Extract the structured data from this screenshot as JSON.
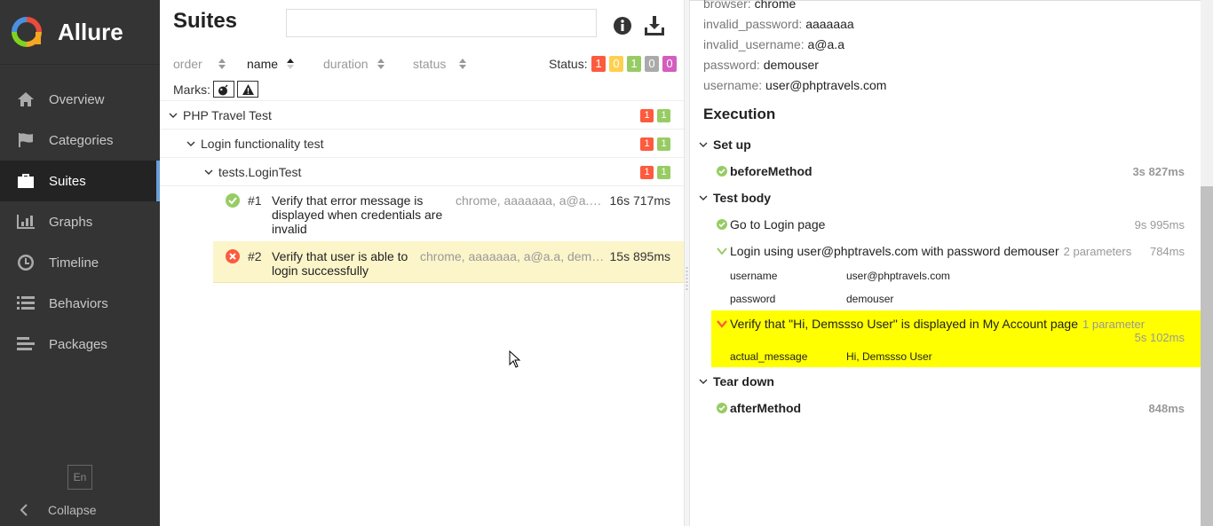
{
  "app": {
    "name": "Allure"
  },
  "sidebar": {
    "items": [
      {
        "label": "Overview",
        "icon": "home-icon"
      },
      {
        "label": "Categories",
        "icon": "flag-icon"
      },
      {
        "label": "Suites",
        "icon": "briefcase-icon",
        "active": true
      },
      {
        "label": "Graphs",
        "icon": "bar-chart-icon"
      },
      {
        "label": "Timeline",
        "icon": "clock-icon"
      },
      {
        "label": "Behaviors",
        "icon": "list-icon"
      },
      {
        "label": "Packages",
        "icon": "align-left-icon"
      }
    ],
    "language": "En",
    "collapse_label": "Collapse"
  },
  "suites": {
    "title": "Suites",
    "search_placeholder": "",
    "sort": {
      "order": "order",
      "name": "name",
      "duration": "duration",
      "status": "status"
    },
    "status_label": "Status:",
    "status_counts": {
      "failed": "1",
      "broken": "0",
      "passed": "1",
      "skipped": "0",
      "unknown": "0"
    },
    "marks_label": "Marks:",
    "tree": {
      "suite": {
        "name": "PHP Travel Test",
        "failed": "1",
        "passed": "1"
      },
      "test": {
        "name": "Login functionality test",
        "failed": "1",
        "passed": "1"
      },
      "class": {
        "name": "tests.LoginTest",
        "failed": "1",
        "passed": "1"
      },
      "cases": [
        {
          "num": "#1",
          "line1": "Verify that error message is",
          "line2": "displayed when credentials are",
          "line3": "invalid",
          "params": "chrome, aaaaaaa, a@a.a…",
          "duration": "16s 717ms",
          "status": "passed"
        },
        {
          "num": "#2",
          "line1": "Verify that user is able to",
          "line2": "login successfully",
          "params": "chrome, aaaaaaa, a@a.a, dem…",
          "duration": "15s 895ms",
          "status": "failed"
        }
      ]
    }
  },
  "details": {
    "params": [
      {
        "key": "browser",
        "value": "chrome"
      },
      {
        "key": "invalid_password",
        "value": "aaaaaaa"
      },
      {
        "key": "invalid_username",
        "value": "a@a.a"
      },
      {
        "key": "password",
        "value": "demouser"
      },
      {
        "key": "username",
        "value": "user@phptravels.com"
      }
    ],
    "execution_title": "Execution",
    "setup": {
      "title": "Set up",
      "step": "beforeMethod",
      "duration": "3s 827ms"
    },
    "body": {
      "title": "Test body",
      "step1": {
        "name": "Go to Login page",
        "duration": "9s 995ms"
      },
      "step2": {
        "name": "Login using user@phptravels.com with password demouser",
        "params_count": "2 parameters",
        "duration": "784ms",
        "params": [
          {
            "key": "username",
            "value": "user@phptravels.com"
          },
          {
            "key": "password",
            "value": "demouser"
          }
        ]
      },
      "step3": {
        "name": "Verify that \"Hi, Demssso User\" is displayed in My Account page",
        "params_count": "1 parameter",
        "duration": "5s 102ms",
        "params": [
          {
            "key": "actual_message",
            "value": "Hi, Demssso User"
          }
        ]
      }
    },
    "teardown": {
      "title": "Tear down",
      "step": "afterMethod",
      "duration": "848ms"
    }
  },
  "colors": {
    "failed": "#fd5a3e",
    "broken": "#ffd050",
    "passed": "#97cc64",
    "skipped": "#aaaaaa",
    "unknown": "#d35ebe",
    "sidebar": "#343434",
    "highlight": "#ffff00"
  }
}
